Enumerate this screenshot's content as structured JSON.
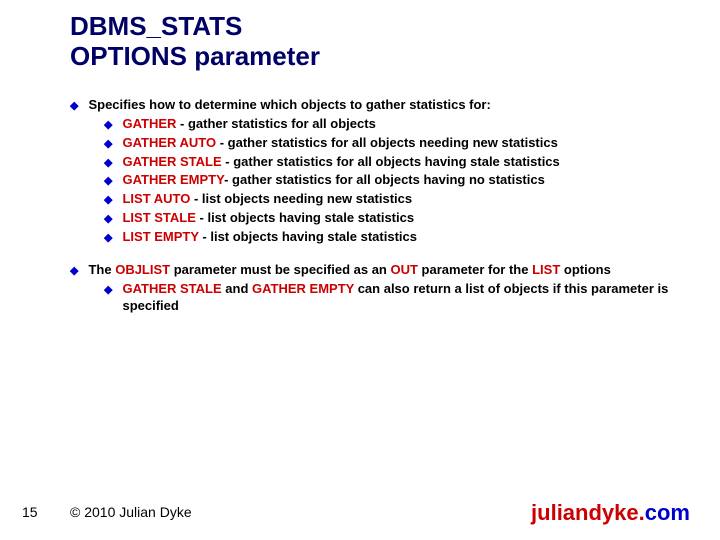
{
  "title_line1": "DBMS_STATS",
  "title_line2": "OPTIONS parameter",
  "b1_intro": "Specifies how to determine which objects to gather statistics for:",
  "b1_items": {
    "a_k": "GATHER",
    "a_t": " - gather statistics for all objects",
    "b_k": "GATHER AUTO",
    "b_t": " - gather statistics for all objects needing new statistics",
    "c_k": "GATHER STALE",
    "c_t": " - gather statistics for all objects having stale statistics",
    "d_k": "GATHER EMPTY",
    "d_t": "- gather statistics for all objects having no statistics",
    "e_k": "LIST AUTO",
    "e_t": " - list objects needing new statistics",
    "f_k": "LIST STALE",
    "f_t": " - list objects having stale statistics",
    "g_k": "LIST EMPTY",
    "g_t": " - list objects having stale statistics"
  },
  "b2_pre": "The ",
  "b2_k1": "OBJLIST",
  "b2_mid1": " parameter must  be specified as an ",
  "b2_k2": "OUT",
  "b2_mid2": " parameter for the ",
  "b2_k3": "LIST",
  "b2_post": " options",
  "b2_sub_k1": "GATHER STALE",
  "b2_sub_mid": " and ",
  "b2_sub_k2": "GATHER EMPTY",
  "b2_sub_post": " can also return a list of objects if this parameter is specified",
  "page_number": "15",
  "copyright": "© 2010 Julian Dyke",
  "site_left": "juliandyke.",
  "site_right": "com"
}
